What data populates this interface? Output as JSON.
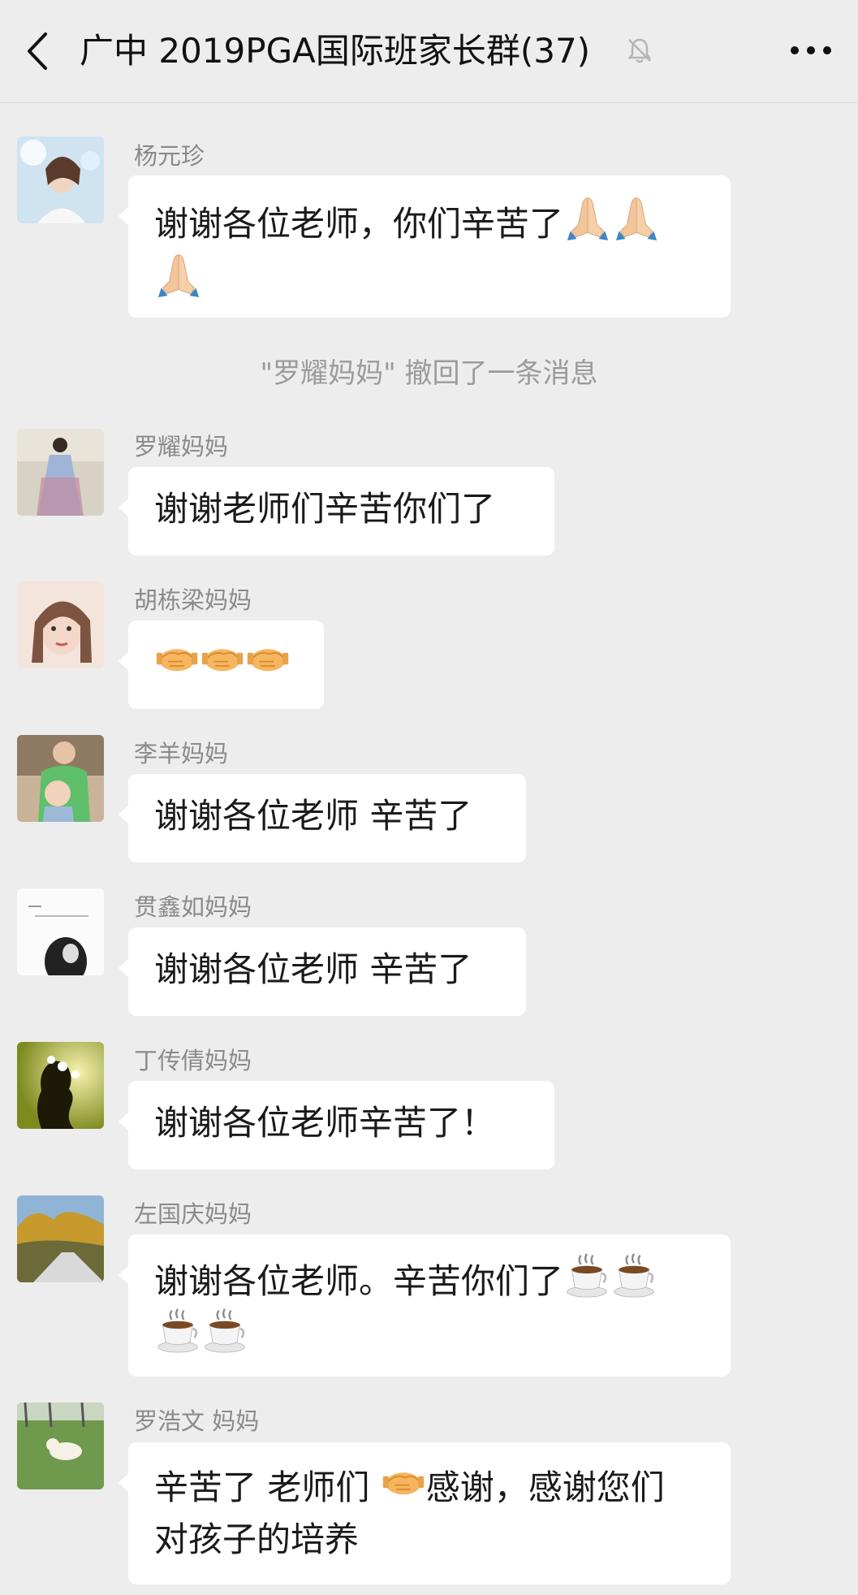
{
  "header": {
    "title": "广中 2019PGA国际班家长群(37)",
    "back_icon": "chevron-left-icon",
    "mute_icon": "bell-off-icon",
    "more_icon": "more-dots-icon"
  },
  "system_notice": "\"罗耀妈妈\" 撤回了一条消息",
  "messages": [
    {
      "sender": "杨元珍",
      "lines": [
        "谢谢各位老师，你们辛苦了",
        ""
      ],
      "emoji": "folded-hands x3"
    },
    {
      "sender": "罗耀妈妈",
      "lines": [
        "谢谢老师们辛苦你们了"
      ]
    },
    {
      "sender": "胡栋梁妈妈",
      "lines": [
        ""
      ],
      "emoji": "handshake x3"
    },
    {
      "sender": "李羊妈妈",
      "lines": [
        "谢谢各位老师 辛苦了"
      ]
    },
    {
      "sender": "贯鑫如妈妈",
      "lines": [
        "谢谢各位老师 辛苦了"
      ]
    },
    {
      "sender": "丁传倩妈妈",
      "lines": [
        "谢谢各位老师辛苦了！"
      ]
    },
    {
      "sender": "左国庆妈妈",
      "lines": [
        "谢谢各位老师。辛苦你们了",
        ""
      ],
      "emoji": "hot-beverage x4"
    },
    {
      "sender": "罗浩文 妈妈",
      "lines": [
        "辛苦了 老师们 ",
        "对孩子的培养"
      ],
      "line1_tail": "感谢，感谢您们",
      "emoji": "handshake x1"
    }
  ],
  "colors": {
    "background": "#ededed",
    "bubble": "#ffffff",
    "sender_text": "#8a8a8a",
    "system_text": "#9b9b9b"
  }
}
